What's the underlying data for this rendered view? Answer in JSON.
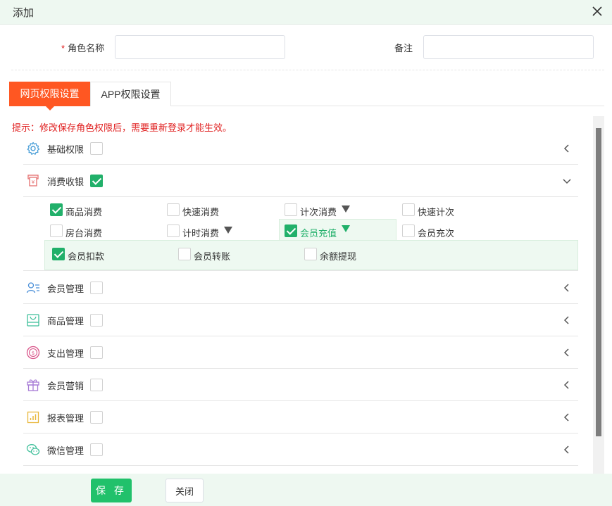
{
  "dialog": {
    "title": "添加"
  },
  "form": {
    "role_name_label": "角色名称",
    "role_name_required": "*",
    "role_name_value": "",
    "remark_label": "备注",
    "remark_value": ""
  },
  "tabs": [
    {
      "label": "网页权限设置",
      "active": true
    },
    {
      "label": "APP权限设置",
      "active": false
    }
  ],
  "hint": "提示：修改保存角色权限后，需要重新登录才能生效。",
  "modules": [
    {
      "name": "基础权限",
      "icon": "gear-icon",
      "checked": false,
      "expanded": false
    },
    {
      "name": "消费收银",
      "icon": "receipt-icon",
      "checked": true,
      "expanded": true
    },
    {
      "name": "会员管理",
      "icon": "member-icon",
      "checked": false,
      "expanded": false
    },
    {
      "name": "商品管理",
      "icon": "goods-icon",
      "checked": false,
      "expanded": false
    },
    {
      "name": "支出管理",
      "icon": "coin-icon",
      "checked": false,
      "expanded": false
    },
    {
      "name": "会员营销",
      "icon": "gift-icon",
      "checked": false,
      "expanded": false
    },
    {
      "name": "报表管理",
      "icon": "report-icon",
      "checked": false,
      "expanded": false
    },
    {
      "name": "微信管理",
      "icon": "wechat-icon",
      "checked": false,
      "expanded": false
    }
  ],
  "cashier_items": [
    {
      "label": "商品消费",
      "checked": true,
      "has_sub": false
    },
    {
      "label": "快速消费",
      "checked": false,
      "has_sub": false
    },
    {
      "label": "计次消费",
      "checked": false,
      "has_sub": true
    },
    {
      "label": "快速计次",
      "checked": false,
      "has_sub": false
    },
    {
      "label": "房台消费",
      "checked": false,
      "has_sub": false
    },
    {
      "label": "计时消费",
      "checked": false,
      "has_sub": true
    },
    {
      "label": "会员充值",
      "checked": true,
      "has_sub": true,
      "active": true
    },
    {
      "label": "会员充次",
      "checked": false,
      "has_sub": false
    }
  ],
  "recharge_sub_items": [
    {
      "label": "会员扣款",
      "checked": true
    },
    {
      "label": "会员转账",
      "checked": false
    },
    {
      "label": "余额提现",
      "checked": false
    }
  ],
  "footer": {
    "save_label": "保 存",
    "close_label": "关闭"
  },
  "colors": {
    "accent": "#ff5722",
    "check": "#21b06a",
    "save": "#21c16b",
    "hint": "#e02020"
  }
}
